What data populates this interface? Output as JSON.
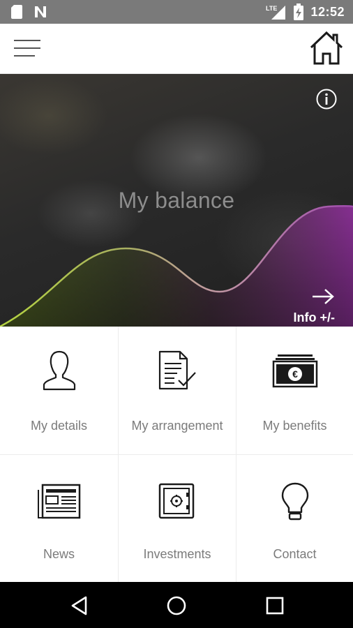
{
  "status_bar": {
    "time": "12:52",
    "network_label": "LTE",
    "icons": [
      "sd-card-icon",
      "n-notification-icon",
      "lte-signal-icon",
      "battery-charging-icon"
    ]
  },
  "app_bar": {
    "menu_icon": "hamburger-menu-icon",
    "home_icon": "home-icon"
  },
  "hero": {
    "title": "My balance",
    "info_icon": "info-icon",
    "link_label": "Info +/-",
    "link_icon": "arrow-right-icon",
    "wave_colors": {
      "start": "#b5d441",
      "middle": "#c29aa3",
      "end": "#8a2f96"
    }
  },
  "tiles": [
    {
      "label": "My details",
      "icon": "person-icon"
    },
    {
      "label": "My arrangement",
      "icon": "document-check-icon"
    },
    {
      "label": "My benefits",
      "icon": "euro-banknotes-icon"
    },
    {
      "label": "News",
      "icon": "newspaper-icon"
    },
    {
      "label": "Investments",
      "icon": "safe-icon"
    },
    {
      "label": "Contact",
      "icon": "lightbulb-icon"
    }
  ],
  "nav_bar": {
    "icons": [
      "back-triangle-icon",
      "home-circle-icon",
      "recents-square-icon"
    ]
  }
}
